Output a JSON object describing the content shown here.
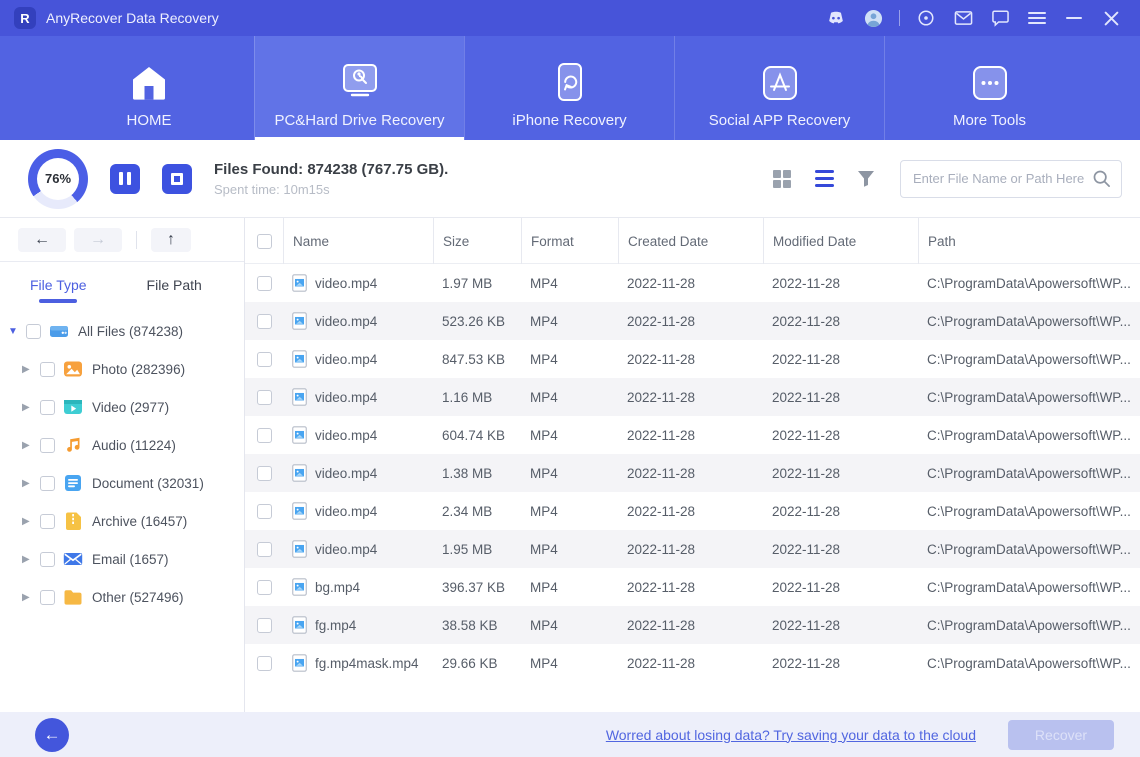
{
  "colors": {
    "titlebar_bg": "#4754d9",
    "nav_bg": "#5263e2",
    "nav_active_bg": "#6173e7",
    "accent_blue": "#3d52e0",
    "sidebar_active_tab": "#4c5fe0",
    "row_alt_bg": "#f4f4f7",
    "footer_bg": "#edeffa",
    "link_color": "#5166e0",
    "recover_disabled_bg": "#b9c1ef"
  },
  "titlebar": {
    "app_title": "AnyRecover Data Recovery",
    "icons": [
      "discord-icon",
      "account-avatar",
      "target-icon",
      "mail-icon",
      "feedback-icon",
      "menu-icon",
      "minimize-icon",
      "close-icon"
    ]
  },
  "nav": {
    "tabs": [
      {
        "label": "HOME",
        "icon": "home-icon",
        "active": false
      },
      {
        "label": "PC&Hard Drive Recovery",
        "icon": "pc-recovery-icon",
        "active": true
      },
      {
        "label": "iPhone Recovery",
        "icon": "iphone-recovery-icon",
        "active": false
      },
      {
        "label": "Social APP Recovery",
        "icon": "social-app-recovery-icon",
        "active": false
      },
      {
        "label": "More Tools",
        "icon": "more-tools-icon",
        "active": false
      }
    ]
  },
  "scan": {
    "progress_percent": "76%",
    "files_found": "Files Found: 874238 (767.75 GB).",
    "spent_time": "Spent time: 10m15s"
  },
  "toolbar": {
    "view_icons": [
      "grid-view-icon",
      "list-view-icon",
      "filter-icon"
    ],
    "active_view": "list",
    "search_placeholder": "Enter File Name or Path Here"
  },
  "sidebar": {
    "tabs": [
      {
        "label": "File Type",
        "active": true
      },
      {
        "label": "File Path",
        "active": false
      }
    ],
    "tree": [
      {
        "name": "All Files",
        "count": "874238",
        "icon": "drive",
        "root": true
      },
      {
        "name": "Photo",
        "count": "282396",
        "icon": "photo",
        "root": false
      },
      {
        "name": "Video",
        "count": "2977",
        "icon": "video",
        "root": false
      },
      {
        "name": "Audio",
        "count": "11224",
        "icon": "audio",
        "root": false
      },
      {
        "name": "Document",
        "count": "32031",
        "icon": "document",
        "root": false
      },
      {
        "name": "Archive",
        "count": "16457",
        "icon": "archive",
        "root": false
      },
      {
        "name": "Email",
        "count": "1657",
        "icon": "email",
        "root": false
      },
      {
        "name": "Other",
        "count": "527496",
        "icon": "folder",
        "root": false
      }
    ]
  },
  "table": {
    "columns": [
      "Name",
      "Size",
      "Format",
      "Created Date",
      "Modified Date",
      "Path"
    ],
    "rows": [
      {
        "name": "video.mp4",
        "size": "1.97 MB",
        "format": "MP4",
        "created": "2022-11-28",
        "modified": "2022-11-28",
        "path": "C:\\ProgramData\\Apowersoft\\WP..."
      },
      {
        "name": "video.mp4",
        "size": "523.26 KB",
        "format": "MP4",
        "created": "2022-11-28",
        "modified": "2022-11-28",
        "path": "C:\\ProgramData\\Apowersoft\\WP..."
      },
      {
        "name": "video.mp4",
        "size": "847.53 KB",
        "format": "MP4",
        "created": "2022-11-28",
        "modified": "2022-11-28",
        "path": "C:\\ProgramData\\Apowersoft\\WP..."
      },
      {
        "name": "video.mp4",
        "size": "1.16 MB",
        "format": "MP4",
        "created": "2022-11-28",
        "modified": "2022-11-28",
        "path": "C:\\ProgramData\\Apowersoft\\WP..."
      },
      {
        "name": "video.mp4",
        "size": "604.74 KB",
        "format": "MP4",
        "created": "2022-11-28",
        "modified": "2022-11-28",
        "path": "C:\\ProgramData\\Apowersoft\\WP..."
      },
      {
        "name": "video.mp4",
        "size": "1.38 MB",
        "format": "MP4",
        "created": "2022-11-28",
        "modified": "2022-11-28",
        "path": "C:\\ProgramData\\Apowersoft\\WP..."
      },
      {
        "name": "video.mp4",
        "size": "2.34 MB",
        "format": "MP4",
        "created": "2022-11-28",
        "modified": "2022-11-28",
        "path": "C:\\ProgramData\\Apowersoft\\WP..."
      },
      {
        "name": "video.mp4",
        "size": "1.95 MB",
        "format": "MP4",
        "created": "2022-11-28",
        "modified": "2022-11-28",
        "path": "C:\\ProgramData\\Apowersoft\\WP..."
      },
      {
        "name": "bg.mp4",
        "size": "396.37 KB",
        "format": "MP4",
        "created": "2022-11-28",
        "modified": "2022-11-28",
        "path": "C:\\ProgramData\\Apowersoft\\WP..."
      },
      {
        "name": "fg.mp4",
        "size": "38.58 KB",
        "format": "MP4",
        "created": "2022-11-28",
        "modified": "2022-11-28",
        "path": "C:\\ProgramData\\Apowersoft\\WP..."
      },
      {
        "name": "fg.mp4mask.mp4",
        "size": "29.66 KB",
        "format": "MP4",
        "created": "2022-11-28",
        "modified": "2022-11-28",
        "path": "C:\\ProgramData\\Apowersoft\\WP..."
      }
    ]
  },
  "footer": {
    "cloud_link": "Worred about losing data? Try saving your data to the cloud",
    "recover_label": "Recover"
  }
}
